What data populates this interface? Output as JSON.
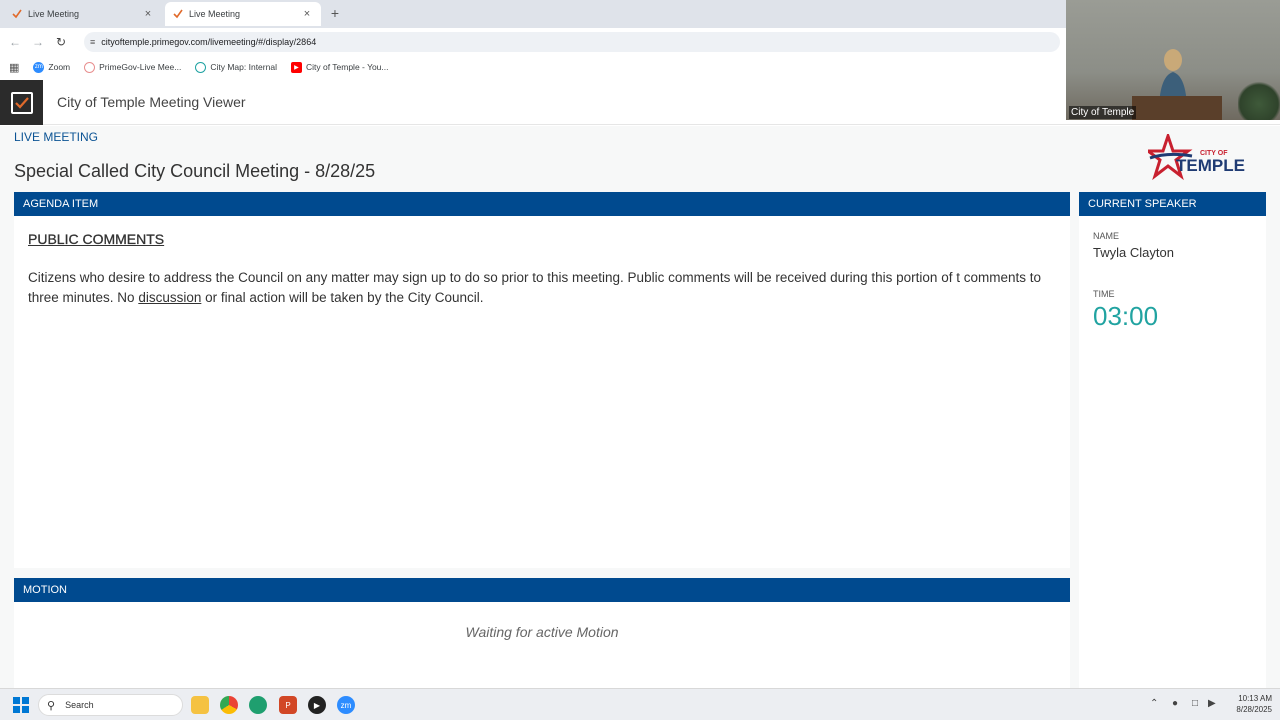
{
  "browser": {
    "tabs": [
      {
        "title": "Live Meeting",
        "active": false,
        "close": "×"
      },
      {
        "title": "Live Meeting",
        "active": true,
        "close": "×"
      }
    ],
    "new_tab": "+",
    "url": "cityoftemple.primegov.com/livemeeting/#/display/2864",
    "bookmarks": [
      {
        "label": "Zoom",
        "color": "#2d8cff"
      },
      {
        "label": "PrimeGov-Live Mee...",
        "color": "#e88f8f"
      },
      {
        "label": "City Map: Internal",
        "color": "#1fa2a2"
      },
      {
        "label": "City of Temple - You...",
        "color": "#ff0000"
      }
    ]
  },
  "app": {
    "title": "City of Temple Meeting Viewer",
    "live_label": "LIVE MEETING",
    "meeting_title": "Special Called City Council Meeting - 8/28/25",
    "logo_small": "CITY OF",
    "logo_big": "TEMPLE",
    "colors": {
      "header": "#004a8f",
      "timer": "#21a3a1"
    }
  },
  "agenda": {
    "header": "AGENDA ITEM",
    "section": "PUBLIC COMMENTS",
    "body_part1": "Citizens who desire to address the Council on any matter may sign up to do so prior to this meeting. Public comments will be received during this portion of t comments to three minutes. No ",
    "body_link": "discussion",
    "body_part2": " or final action will be taken by the City Council."
  },
  "speaker": {
    "header": "CURRENT SPEAKER",
    "name_label": "NAME",
    "name": "Twyla Clayton",
    "time_label": "TIME",
    "time": "03:00"
  },
  "motion": {
    "header": "MOTION",
    "waiting": "Waiting for active Motion"
  },
  "video": {
    "caption": "City of Temple"
  },
  "taskbar": {
    "search_placeholder": "Search",
    "time": "10:13 AM",
    "date": "8/28/2025"
  }
}
